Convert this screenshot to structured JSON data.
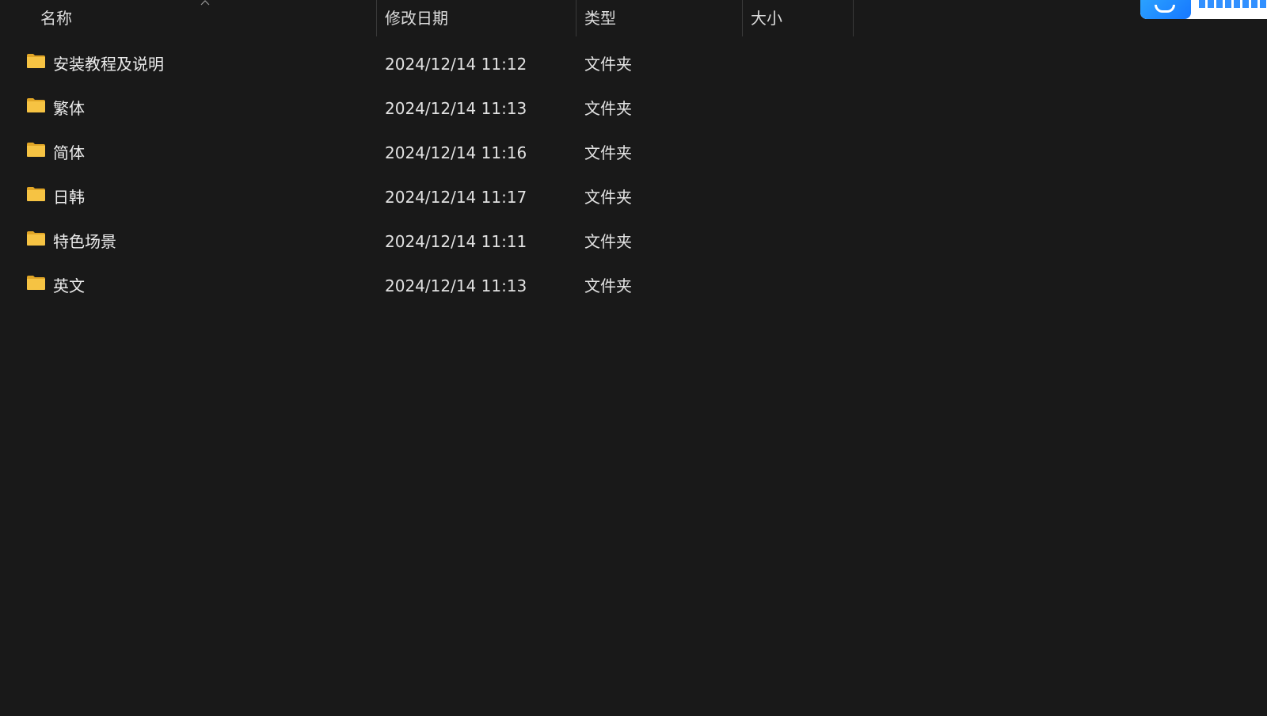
{
  "columns": {
    "name": "名称",
    "date": "修改日期",
    "type": "类型",
    "size": "大小"
  },
  "sort": {
    "column": "name",
    "direction": "ascending",
    "icon": "chevron-up-icon"
  },
  "files": [
    {
      "name": "安装教程及说明",
      "date": "2024/12/14 11:12",
      "type": "文件夹",
      "size": "",
      "icon": "folder-icon"
    },
    {
      "name": "繁体",
      "date": "2024/12/14 11:13",
      "type": "文件夹",
      "size": "",
      "icon": "folder-icon"
    },
    {
      "name": "简体",
      "date": "2024/12/14 11:16",
      "type": "文件夹",
      "size": "",
      "icon": "folder-icon"
    },
    {
      "name": "日韩",
      "date": "2024/12/14 11:17",
      "type": "文件夹",
      "size": "",
      "icon": "folder-icon"
    },
    {
      "name": "特色场景",
      "date": "2024/12/14 11:11",
      "type": "文件夹",
      "size": "",
      "icon": "folder-icon"
    },
    {
      "name": "英文",
      "date": "2024/12/14 11:13",
      "type": "文件夹",
      "size": "",
      "icon": "folder-icon"
    }
  ],
  "colors": {
    "background": "#191919",
    "text": "#e8e8e8",
    "folder": "#f6c343",
    "badge_accent": "#1677ff"
  }
}
